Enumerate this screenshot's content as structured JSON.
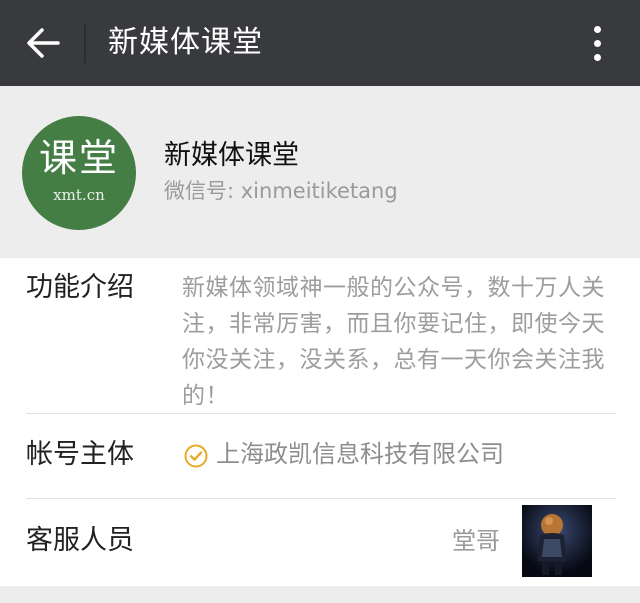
{
  "header": {
    "title": "新媒体课堂",
    "back_icon": "back-arrow-icon",
    "more_icon": "more-vertical-icon",
    "background": "#393a3e"
  },
  "profile": {
    "avatar_text": "课堂",
    "avatar_subtext": "xmt.cn",
    "avatar_color": "#447e44",
    "name": "新媒体课堂",
    "wechat_id": "微信号: xinmeitiketang"
  },
  "info": {
    "intro_label": "功能介绍",
    "intro_text": "新媒体领域神一般的公众号，数十万人关注，非常厉害，而且你要记住，即使今天你没关注，没关系，总有一天你会关注我的！",
    "owner_label": "帐号主体",
    "owner_value": "上海政凯信息科技有限公司",
    "owner_icon": "verified-check-icon",
    "owner_icon_color": "#e9a928",
    "service_label": "客服人员",
    "service_name": "堂哥"
  }
}
